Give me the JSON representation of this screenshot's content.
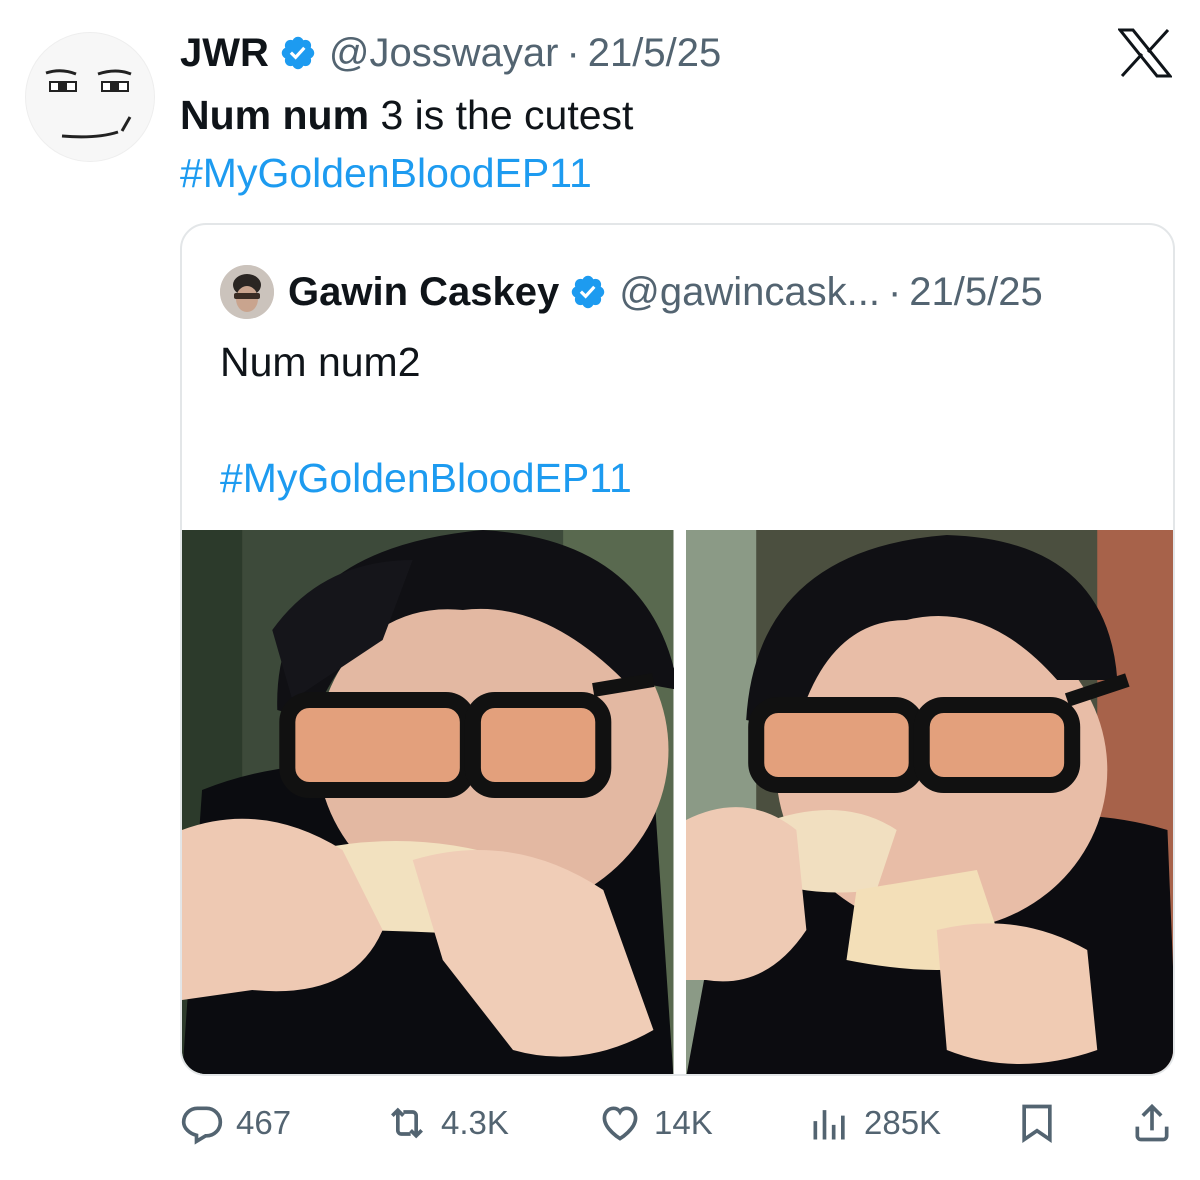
{
  "tweet": {
    "display_name": "JWR",
    "handle": "@Josswayar",
    "separator": "·",
    "date": "21/5/25",
    "text_bold": "Num num",
    "text_rest": " 3 is the cutest",
    "hashtag": "#MyGoldenBloodEP11"
  },
  "quote": {
    "display_name": "Gawin Caskey",
    "handle": "@gawincask...",
    "separator": "·",
    "date": "21/5/25",
    "text": "Num num2",
    "hashtag": "#MyGoldenBloodEP11"
  },
  "actions": {
    "replies": "467",
    "reposts": "4.3K",
    "likes": "14K",
    "views": "285K"
  },
  "icons": {
    "verified": "verified-badge-icon",
    "platform": "x-logo-icon",
    "reply": "reply-icon",
    "repost": "repost-icon",
    "like": "heart-icon",
    "views": "views-icon",
    "bookmark": "bookmark-icon",
    "share": "share-icon"
  },
  "colors": {
    "link": "#1d9bf0",
    "secondary_text": "#536471",
    "verified": "#1d9bf0"
  }
}
